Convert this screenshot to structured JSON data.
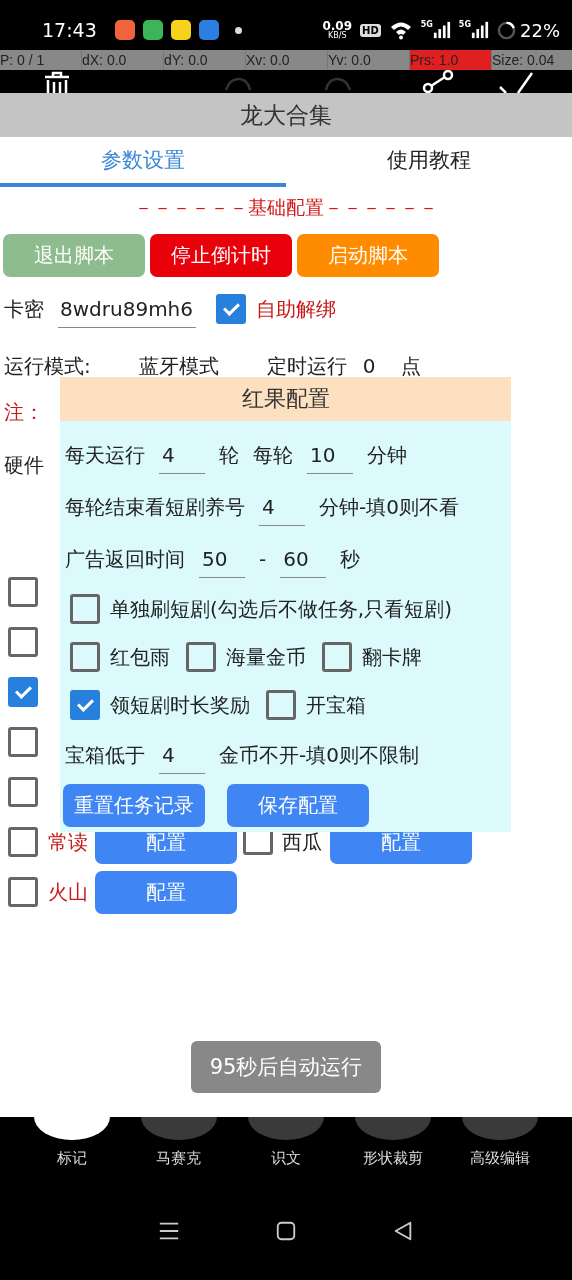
{
  "status_bar": {
    "time": "17:43",
    "apps": [
      {
        "color": "#f0643c"
      },
      {
        "color": "#3cb55a"
      },
      {
        "color": "#f7d21c"
      },
      {
        "color": "#2a7fe0"
      }
    ],
    "net_speed": "0.09",
    "net_unit": "KB/S",
    "hd": "HD",
    "signals": [
      "5G",
      "5G"
    ],
    "battery": "22%"
  },
  "pointer_bar": [
    {
      "text": "P: 0 / 1",
      "alert": false
    },
    {
      "text": "dX: 0.0",
      "alert": false
    },
    {
      "text": "dY: 0.0",
      "alert": false
    },
    {
      "text": "Xv: 0.0",
      "alert": false
    },
    {
      "text": "Yv: 0.0",
      "alert": false
    },
    {
      "text": "Prs: 1.0",
      "alert": true
    },
    {
      "text": "Size: 0.04",
      "alert": false
    }
  ],
  "title": "龙大合集",
  "tabs": [
    {
      "label": "参数设置",
      "selected": true
    },
    {
      "label": "使用教程",
      "selected": false
    }
  ],
  "section_heading": "－－－－－－基础配置－－－－－－",
  "action_buttons": [
    {
      "label": "退出脚本",
      "color": "#8fbc8f"
    },
    {
      "label": "停止倒计时",
      "color": "#e8000b"
    },
    {
      "label": "启动脚本",
      "color": "#ff8c00"
    }
  ],
  "card_key": {
    "label": "卡密",
    "value": "8wdru89mh6"
  },
  "self_unbind": {
    "label": "自助解绑",
    "checked": true
  },
  "run_mode": {
    "label": "运行模式:",
    "value": "蓝牙模式",
    "timer_label": "定时运行",
    "timer_value": "0",
    "timer_unit": "点"
  },
  "note": "注：",
  "hardware": "硬件",
  "apps_list": [
    {
      "checked": false
    },
    {
      "checked": false
    },
    {
      "checked": true
    },
    {
      "checked": false
    },
    {
      "checked": false
    },
    {
      "checked": false,
      "label": "常读",
      "button": "配置",
      "extra": {
        "checked": false,
        "label": "西瓜",
        "button": "配置"
      }
    },
    {
      "checked": false,
      "label": "火山",
      "button": "配置"
    }
  ],
  "dialog": {
    "title": "红果配置",
    "rows": [
      {
        "kind": "fields",
        "parts": [
          {
            "kind": "text",
            "text": "每天运行"
          },
          {
            "kind": "field",
            "value": "4"
          },
          {
            "kind": "text",
            "text": "轮"
          },
          {
            "kind": "text",
            "text": "每轮"
          },
          {
            "kind": "field",
            "value": "10"
          },
          {
            "kind": "text",
            "text": "分钟"
          }
        ]
      },
      {
        "kind": "fields",
        "parts": [
          {
            "kind": "text",
            "text": "每轮结束看短剧养号"
          },
          {
            "kind": "field",
            "value": "4"
          },
          {
            "kind": "text",
            "text": "分钟-填0则不看"
          }
        ]
      },
      {
        "kind": "fields",
        "parts": [
          {
            "kind": "text",
            "text": "广告返回时间"
          },
          {
            "kind": "field",
            "value": "50"
          },
          {
            "kind": "text",
            "text": "-"
          },
          {
            "kind": "field",
            "value": "60"
          },
          {
            "kind": "text",
            "text": "秒"
          }
        ]
      },
      {
        "kind": "checks",
        "items": [
          {
            "label": "单独刷短剧(勾选后不做任务,只看短剧)",
            "checked": false
          }
        ]
      },
      {
        "kind": "checks",
        "items": [
          {
            "label": "红包雨",
            "checked": false
          },
          {
            "label": "海量金币",
            "checked": false
          },
          {
            "label": "翻卡牌",
            "checked": false
          }
        ]
      },
      {
        "kind": "checks",
        "items": [
          {
            "label": "领短剧时长奖励",
            "checked": true
          },
          {
            "label": "开宝箱",
            "checked": false
          }
        ]
      },
      {
        "kind": "fields",
        "parts": [
          {
            "kind": "text",
            "text": "宝箱低于"
          },
          {
            "kind": "field",
            "value": "4"
          },
          {
            "kind": "text",
            "text": "金币不开-填0则不限制"
          }
        ]
      },
      {
        "kind": "buttons",
        "items": [
          "重置任务记录",
          "保存配置"
        ]
      }
    ]
  },
  "toast": "95秒后自动运行",
  "editor_tools": [
    {
      "label": "标记",
      "selected": true
    },
    {
      "label": "马赛克",
      "selected": false
    },
    {
      "label": "识文",
      "selected": false
    },
    {
      "label": "形状裁剪",
      "selected": false
    },
    {
      "label": "高级编辑",
      "selected": false
    }
  ]
}
